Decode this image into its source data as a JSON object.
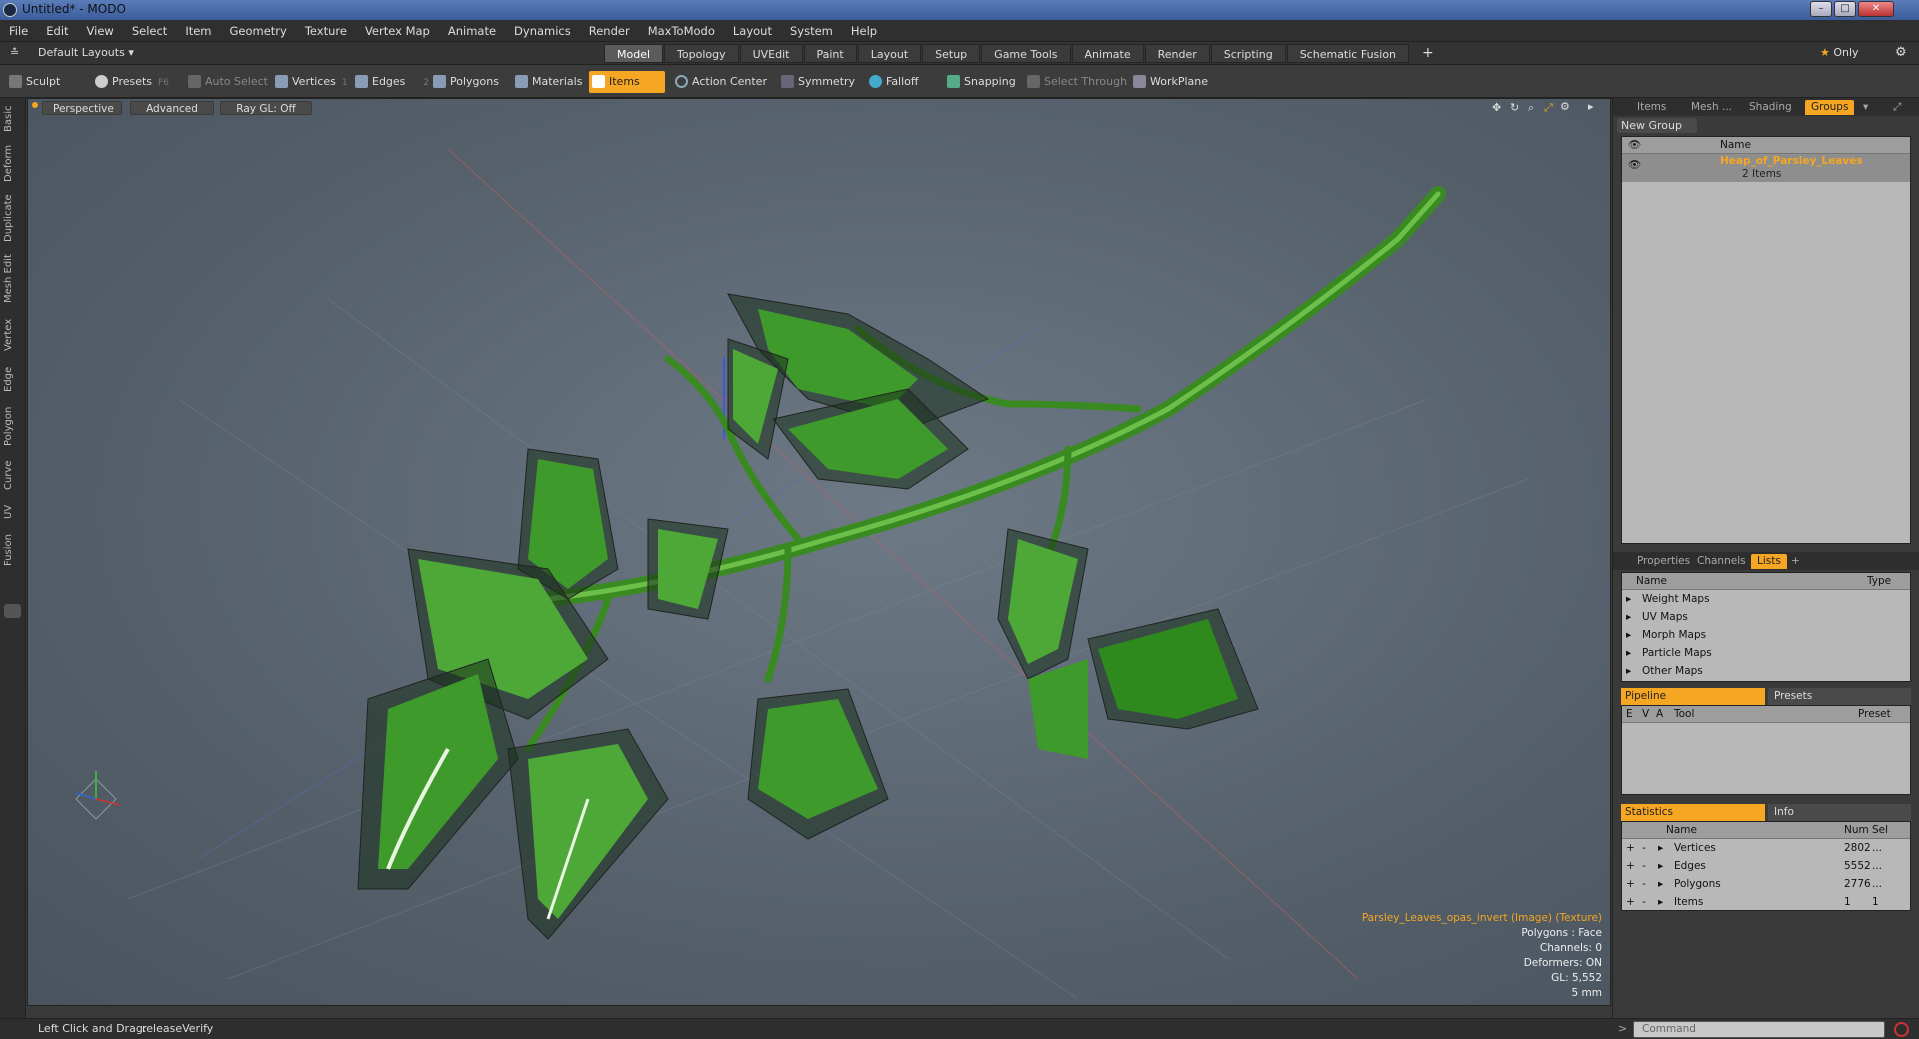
{
  "window": {
    "title": "Untitled* - MODO"
  },
  "menu": [
    "File",
    "Edit",
    "View",
    "Select",
    "Item",
    "Geometry",
    "Texture",
    "Vertex Map",
    "Animate",
    "Dynamics",
    "Render",
    "MaxToModo",
    "Layout",
    "System",
    "Help"
  ],
  "layouts": {
    "label": "Default Layouts",
    "tabs": [
      "Model",
      "Topology",
      "UVEdit",
      "Paint",
      "Layout",
      "Setup",
      "Game Tools",
      "Animate",
      "Render",
      "Scripting",
      "Schematic Fusion"
    ],
    "active": "Model",
    "only": "Only"
  },
  "toolbar": {
    "sculpt": "Sculpt",
    "presets": "Presets",
    "presets_key": "F6",
    "auto_select": "Auto Select",
    "vertices": "Vertices",
    "vertices_key": "1",
    "edges": "Edges",
    "edges_key": "2",
    "polygons": "Polygons",
    "materials": "Materials",
    "items": "Items",
    "action_center": "Action Center",
    "symmetry": "Symmetry",
    "falloff": "Falloff",
    "snapping": "Snapping",
    "select_through": "Select Through",
    "workplane": "WorkPlane"
  },
  "lefttabs": [
    "Basic",
    "Deform",
    "Duplicate",
    "Mesh Edit",
    "Vertex",
    "Edge",
    "Polygon",
    "Curve",
    "UV",
    "Fusion"
  ],
  "viewport": {
    "perspective": "Perspective",
    "advanced": "Advanced",
    "raygl": "Ray GL: Off",
    "info": {
      "texture": "Parsley_Leaves_opas_invert (Image) (Texture)",
      "polygons": "Polygons : Face",
      "channels": "Channels: 0",
      "deformers": "Deformers: ON",
      "gl": "GL: 5,552",
      "scale": "5 mm"
    }
  },
  "items_panel": {
    "tabs": [
      "Items",
      "Mesh ...",
      "Shading",
      "Groups"
    ],
    "active": "Groups",
    "new_group": "New Group",
    "name_col": "Name",
    "group_name": "Heap_of_Parsley_Leaves",
    "group_count": "2 Items"
  },
  "props_panel": {
    "tabs": [
      "Properties",
      "Channels",
      "Lists"
    ],
    "active": "Lists",
    "cols": {
      "name": "Name",
      "type": "Type"
    },
    "maps": [
      "Weight Maps",
      "UV Maps",
      "Morph Maps",
      "Particle Maps",
      "Other Maps"
    ]
  },
  "pipeline": {
    "tab_a": "Pipeline",
    "tab_b": "Presets",
    "cols": [
      "E",
      "V",
      "A",
      "Tool",
      "Preset"
    ]
  },
  "statistics": {
    "tab_a": "Statistics",
    "tab_b": "Info",
    "cols": {
      "name": "Name",
      "num": "Num",
      "sel": "Sel"
    },
    "rows": [
      {
        "name": "Vertices",
        "num": "2802",
        "sel": "..."
      },
      {
        "name": "Edges",
        "num": "5552",
        "sel": "..."
      },
      {
        "name": "Polygons",
        "num": "2776",
        "sel": "..."
      },
      {
        "name": "Items",
        "num": "1",
        "sel": "1"
      }
    ]
  },
  "status": {
    "hint": "Left Click and Drag:",
    "action": "releaseVerify",
    "command_placeholder": "Command"
  },
  "colors": {
    "accent": "#f5a623",
    "leaf": "#3f9a2c",
    "viewport": "#5f6b76"
  }
}
